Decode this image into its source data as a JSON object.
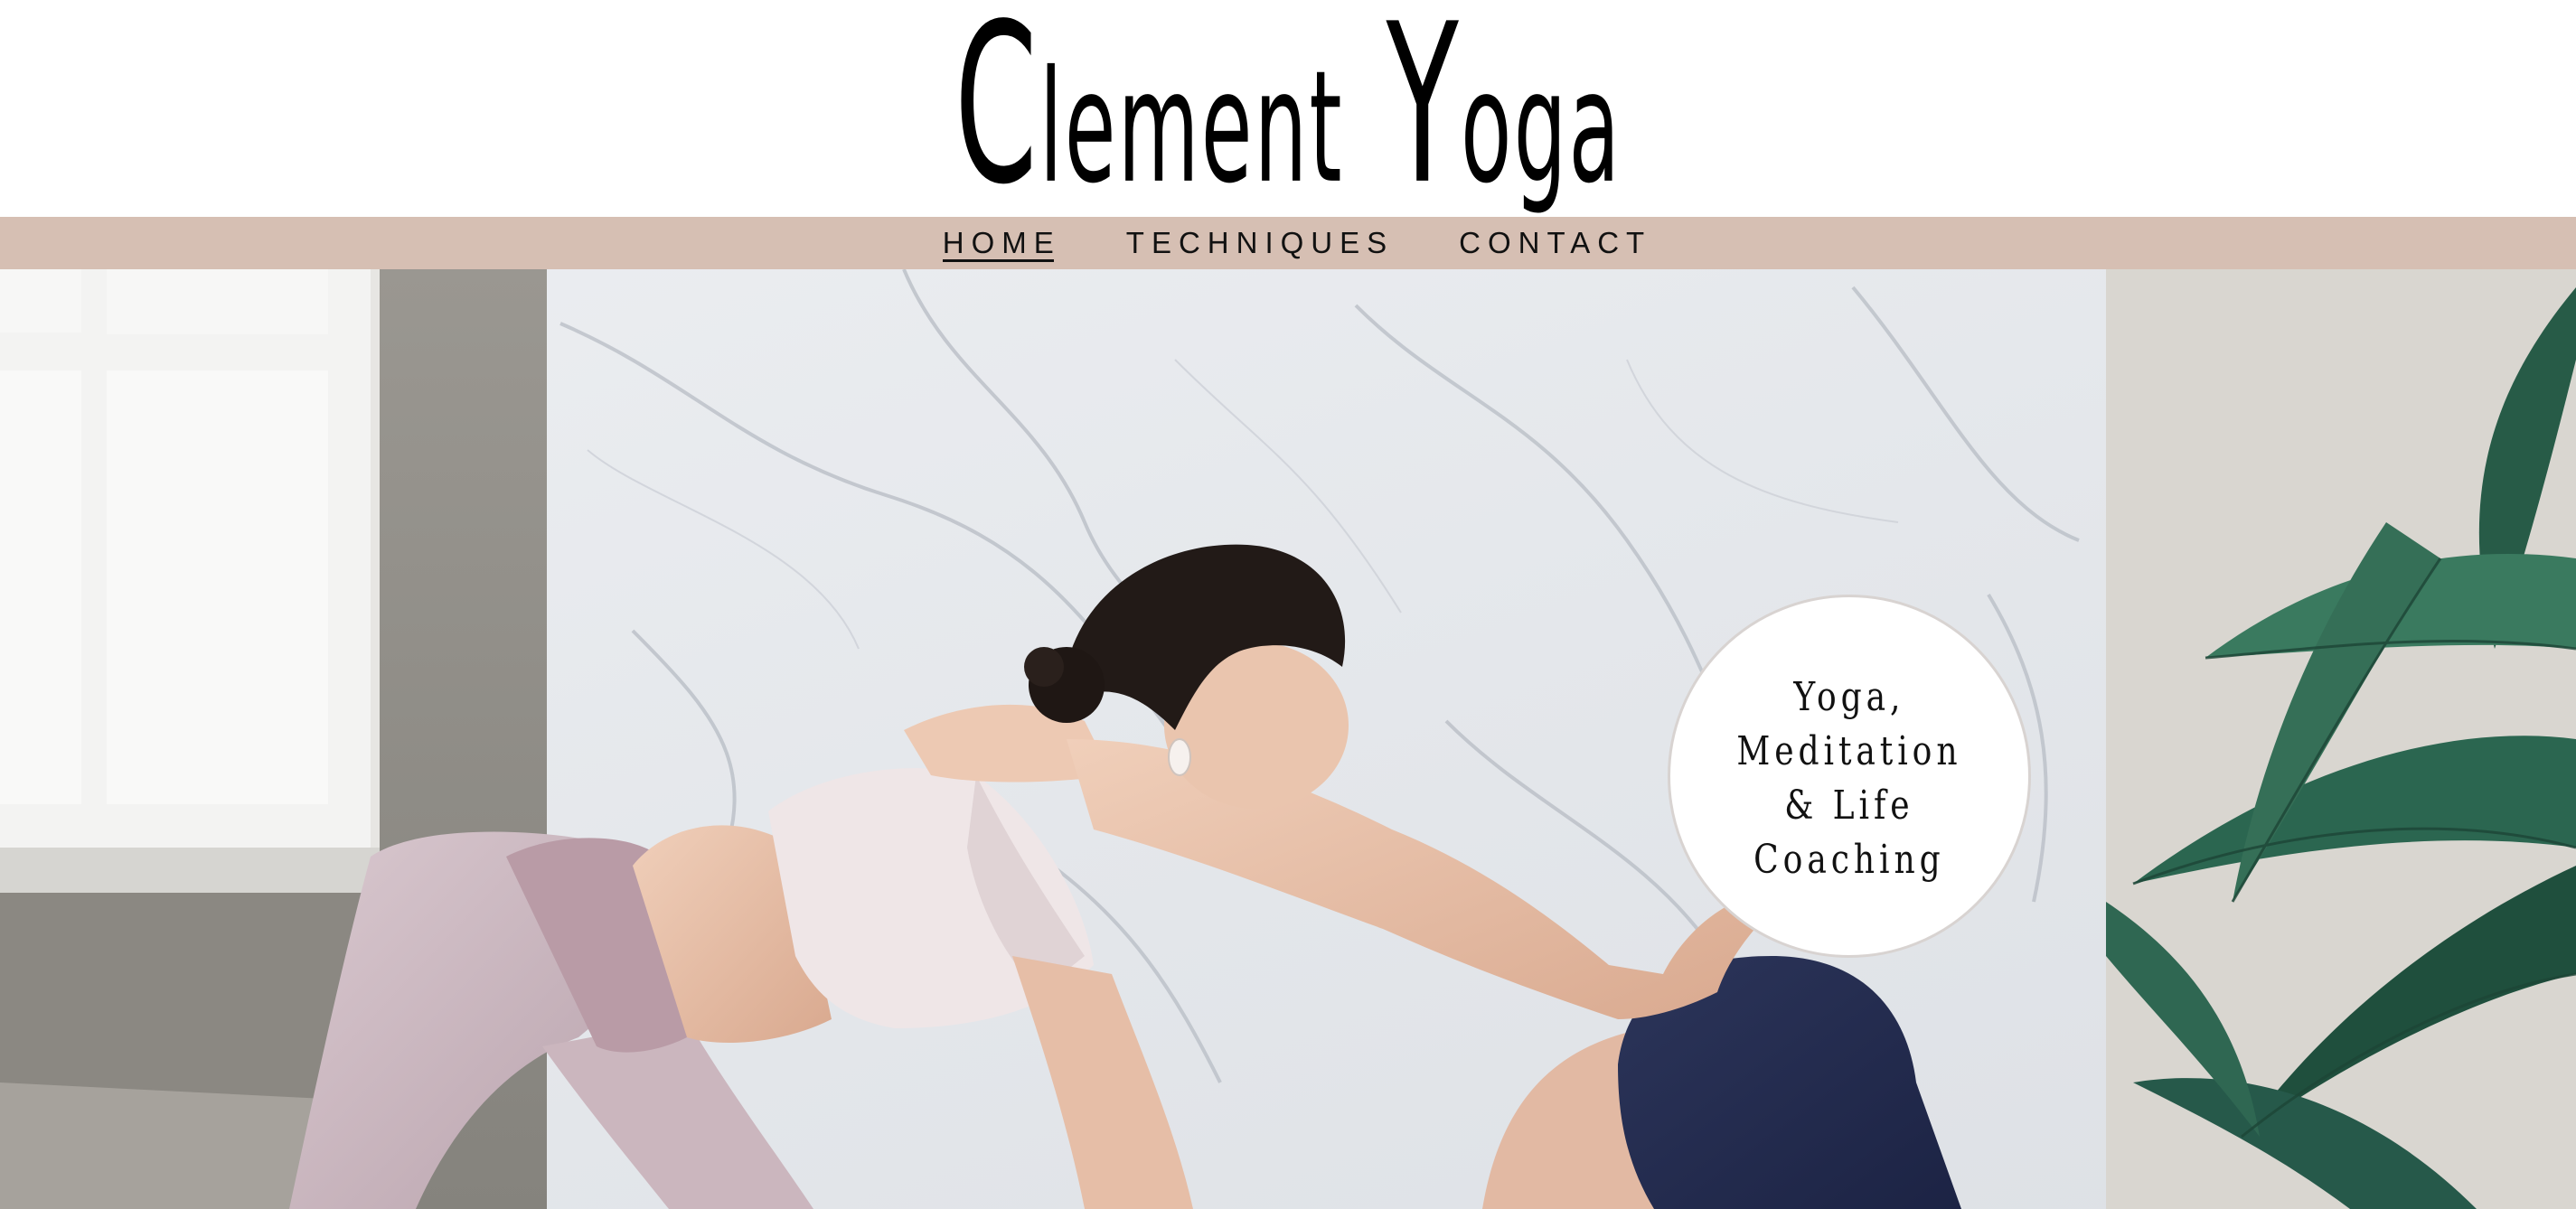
{
  "site": {
    "title_parts": [
      "C",
      "lement",
      "Y",
      "oga"
    ]
  },
  "nav": {
    "items": [
      {
        "label": "HOME"
      },
      {
        "label": "TECHNIQUES"
      },
      {
        "label": "CONTACT"
      }
    ],
    "active_index": 0
  },
  "hero": {
    "badge_lines": "Yoga,\nMeditation\n& Life\nCoaching"
  },
  "colors": {
    "nav_background": "#d6bfb3",
    "title_text": "#000000",
    "nav_text": "#111111",
    "badge_background": "#ffffff"
  }
}
